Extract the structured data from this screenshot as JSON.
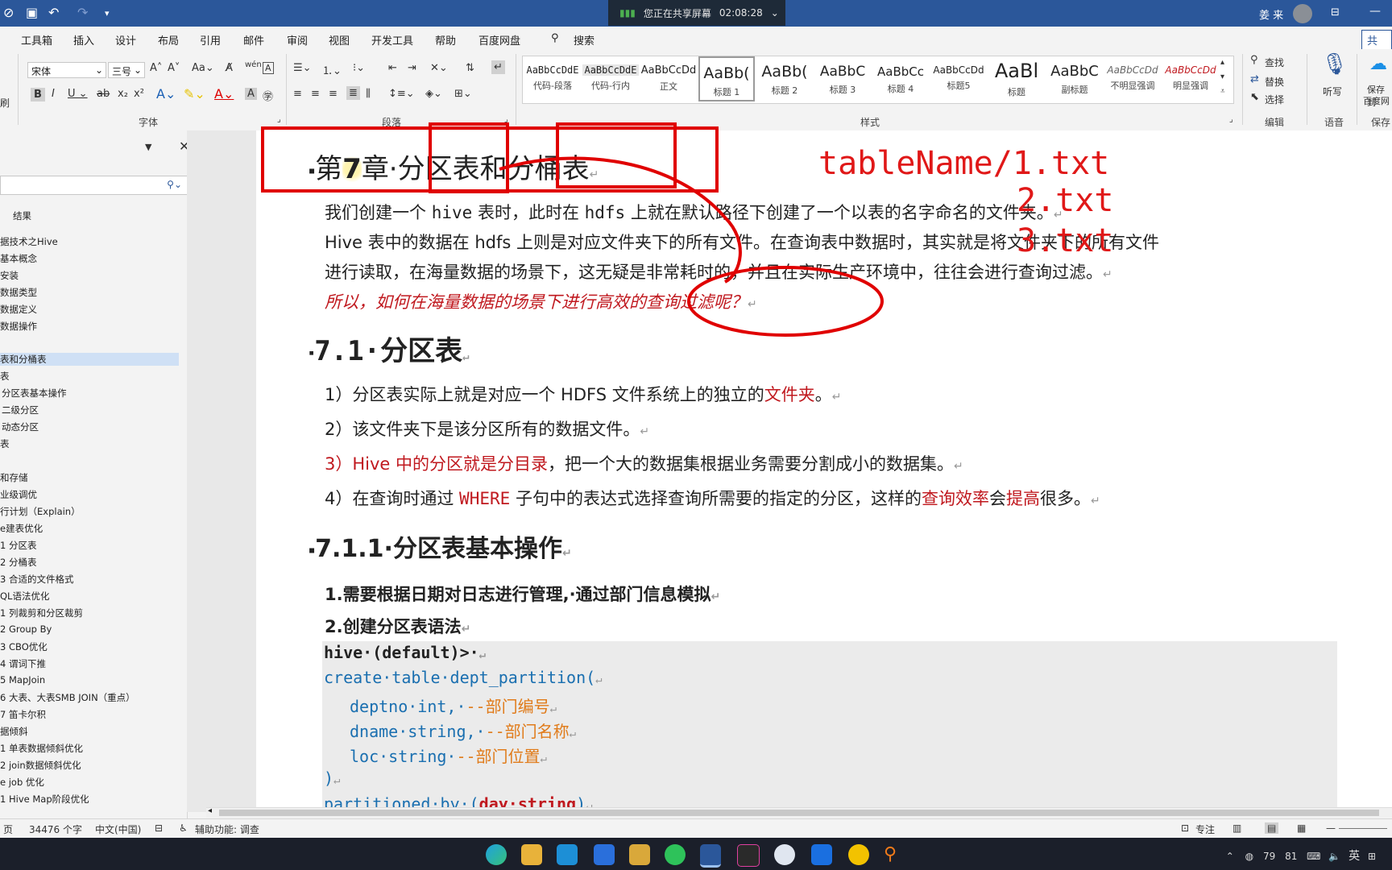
{
  "titlebar": {
    "share_status": "您正在共享屏幕",
    "share_time": "02:08:28",
    "user_name": "姜 来"
  },
  "ribbon_tabs": [
    "工具箱",
    "插入",
    "设计",
    "布局",
    "引用",
    "邮件",
    "审阅",
    "视图",
    "开发工具",
    "帮助",
    "百度网盘",
    "搜索"
  ],
  "share_button": "共享",
  "font_group": {
    "font_name": "宋体",
    "font_size": "三号",
    "label": "字体"
  },
  "paragraph_group": {
    "label": "段落"
  },
  "styles_group": {
    "label": "样式",
    "styles": [
      {
        "sample": "AaBbCcDdE",
        "name": "代码-段落"
      },
      {
        "sample": "AaBbCcDdE",
        "name": "代码-行内"
      },
      {
        "sample": "AaBbCcDd",
        "name": "正文"
      },
      {
        "sample": "AaBb(",
        "name": "标题 1"
      },
      {
        "sample": "AaBb(",
        "name": "标题 2"
      },
      {
        "sample": "AaBbC",
        "name": "标题 3"
      },
      {
        "sample": "AaBbCc",
        "name": "标题 4"
      },
      {
        "sample": "AaBbCcDd",
        "name": "标题5"
      },
      {
        "sample": "AaBl",
        "name": "标题"
      },
      {
        "sample": "AaBbC",
        "name": "副标题"
      },
      {
        "sample": "AaBbCcDd",
        "name": "不明显强调"
      },
      {
        "sample": "AaBbCcDd",
        "name": "明显强调"
      }
    ]
  },
  "editing_group": {
    "find": "查找",
    "replace": "替换",
    "select": "选择",
    "label": "编辑"
  },
  "voice_group": {
    "dictate": "听写",
    "label": "语音"
  },
  "save_group": {
    "line1": "保存到",
    "line2": "百度网",
    "label": "保存"
  },
  "nav": {
    "results_tab": "结果",
    "items": [
      "据技术之Hive",
      "基本概念",
      "安装",
      "数据类型",
      "数据定义",
      "数据操作",
      "表和分桶表",
      "表",
      "分区表基本操作",
      "二级分区",
      "动态分区",
      "表",
      "和存储",
      "业级调优",
      "行计划（Explain）",
      "e建表优化",
      "1 分区表",
      "2 分桶表",
      "3 合适的文件格式",
      "QL语法优化",
      "1 列裁剪和分区裁剪",
      "2 Group By",
      "3 CBO优化",
      "4 谓词下推",
      "5 MapJoin",
      "6 大表、大表SMB JOIN（重点）",
      "7 笛卡尔积",
      "据倾斜",
      "1 单表数据倾斜优化",
      "2 join数据倾斜优化",
      "e job 优化",
      "1 Hive Map阶段优化"
    ]
  },
  "document": {
    "chapter_title_part1": "第",
    "chapter_num": "7",
    "chapter_title_part2": "章·分区表和分桶表",
    "intro1_a": "我们创建一个 ",
    "intro1_hive": "hive",
    "intro1_b": " 表时，此时在 ",
    "intro1_hdfs": "hdfs",
    "intro1_c": " 上就在默认路径下创建了一个以表的名字命名的文件夹。",
    "intro2": "Hive 表中的数据在 hdfs 上则是对应文件夹下的所有文件。在查询表中数据时，其实就是将文件夹下的所有文件",
    "intro3": "进行读取，在海量数据的场景下，这无疑是非常耗时的，并且在实际生产环境中，往往会进行查询过滤。",
    "question": "所以，如何在海量数据的场景下进行高效的查询过滤呢？",
    "h2": "7.1·分区表",
    "p1_a": "1）分区表实际上就是对应一个 HDFS 文件系统上的独立的",
    "p1_red": "文件夹",
    "p1_b": "。",
    "p2": "2）该文件夹下是该分区所有的数据文件。",
    "p3_red": "3）Hive 中的分区就是分目录",
    "p3_b": "，把一个大的数据集根据业务需要分割成小的数据集。",
    "p4_a": "4）在查询时通过 ",
    "p4_where": "WHERE",
    "p4_b": " 子句中的表达式选择查询所需要的指定的分区，这样的",
    "p4_red1": "查询效率",
    "p4_c": "会",
    "p4_red2": "提高",
    "p4_d": "很多。",
    "h3": "7.1.1·分区表基本操作",
    "step1": "1.需要根据日期对日志进行管理,·通过部门信息模拟",
    "step2": "2.创建分区表语法",
    "code": {
      "prompt": "hive·(default)>·",
      "line1": "create·table·dept_partition(",
      "l2_a": "deptno·int,·",
      "l2_c": "--部门编号",
      "l3_a": "dname·string,·",
      "l3_c": "--部门名称",
      "l4_a": "loc·string·",
      "l4_c": "--部门位置",
      "line5": ")",
      "line6_a": "partitioned·by·(",
      "line6_b": "day·string",
      "line6_c": ")"
    }
  },
  "annotations": {
    "line1": "tableName/1.txt",
    "line2": "2.txt",
    "line3": "3.txt"
  },
  "statusbar": {
    "page": "页",
    "word_count": "34476 个字",
    "language": "中文(中国)",
    "accessibility": "辅助功能: 调查",
    "focus": "专注"
  },
  "tray": {
    "num1": "79",
    "num2": "81",
    "ime": "英"
  }
}
